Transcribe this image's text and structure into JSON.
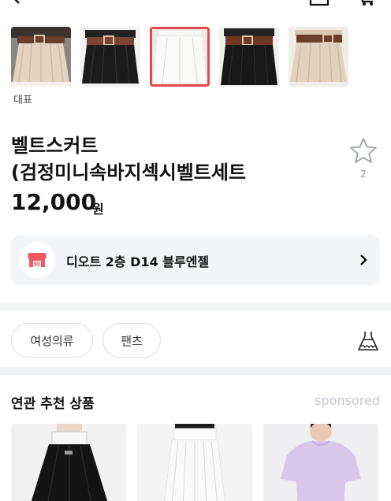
{
  "header": {
    "back_icon": "chevron-left-icon",
    "cart_icon": "cart-icon",
    "store_icon": "storefront-icon"
  },
  "gallery": {
    "caption": "대표",
    "thumbnails": [
      {
        "name": "beige pleated skirt with brown belt",
        "selected": false
      },
      {
        "name": "black pleated skirt with brown belt",
        "selected": false
      },
      {
        "name": "white pleated skirt",
        "selected": true
      },
      {
        "name": "black pleated skirt with brown belt",
        "selected": false
      },
      {
        "name": "beige pleated skirt with brown belt",
        "selected": false
      }
    ]
  },
  "product": {
    "title_line1": "벨트스커트",
    "title_line2": "(검정미니속바지섹시벨트세트",
    "price": "12,000",
    "price_unit": "원",
    "favorite_count": "2"
  },
  "store": {
    "name": "디오트 2층 D14 블루엔젤",
    "logo_color": "#ee5a63"
  },
  "tags": {
    "chip1": "여성의류",
    "chip2": "팬츠"
  },
  "related": {
    "title": "연관 추천 상품",
    "sponsored_label": "sponsored",
    "items": [
      {
        "name": "black flared mini skirt"
      },
      {
        "name": "white pleated mini skirt"
      },
      {
        "name": "lavender short sleeve top"
      }
    ]
  },
  "colors": {
    "selected_outline": "#e5474b",
    "card_bg": "#f4f5f8",
    "sponsored": "#c5c8cf"
  }
}
